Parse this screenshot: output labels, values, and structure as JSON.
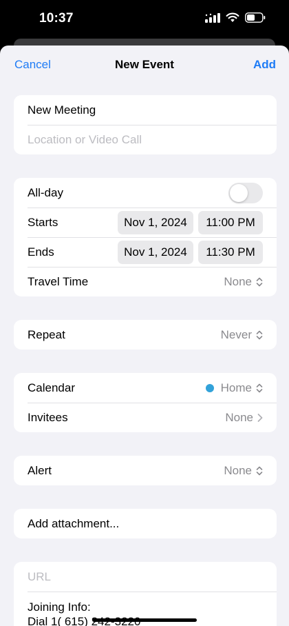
{
  "status": {
    "time": "10:37"
  },
  "nav": {
    "cancel": "Cancel",
    "title": "New Event",
    "add": "Add"
  },
  "title_group": {
    "title_value": "New Meeting",
    "location_placeholder": "Location or Video Call"
  },
  "time_group": {
    "allday_label": "All-day",
    "allday_on": false,
    "starts_label": "Starts",
    "starts_date": "Nov 1, 2024",
    "starts_time": "11:00 PM",
    "ends_label": "Ends",
    "ends_date": "Nov 1, 2024",
    "ends_time": "11:30 PM",
    "travel_label": "Travel Time",
    "travel_value": "None"
  },
  "repeat_group": {
    "label": "Repeat",
    "value": "Never"
  },
  "calendar_group": {
    "calendar_label": "Calendar",
    "calendar_value": "Home",
    "calendar_color": "#32a2d9",
    "invitees_label": "Invitees",
    "invitees_value": "None"
  },
  "alert_group": {
    "label": "Alert",
    "value": "None"
  },
  "attachment_group": {
    "label": "Add attachment..."
  },
  "url_group": {
    "url_placeholder": "URL",
    "notes_line1": "Joining Info:",
    "notes_line2": "Dial 1( 615) 242-3220"
  },
  "colors": {
    "accent": "#1f7cf6",
    "background": "#f2f2f7"
  }
}
